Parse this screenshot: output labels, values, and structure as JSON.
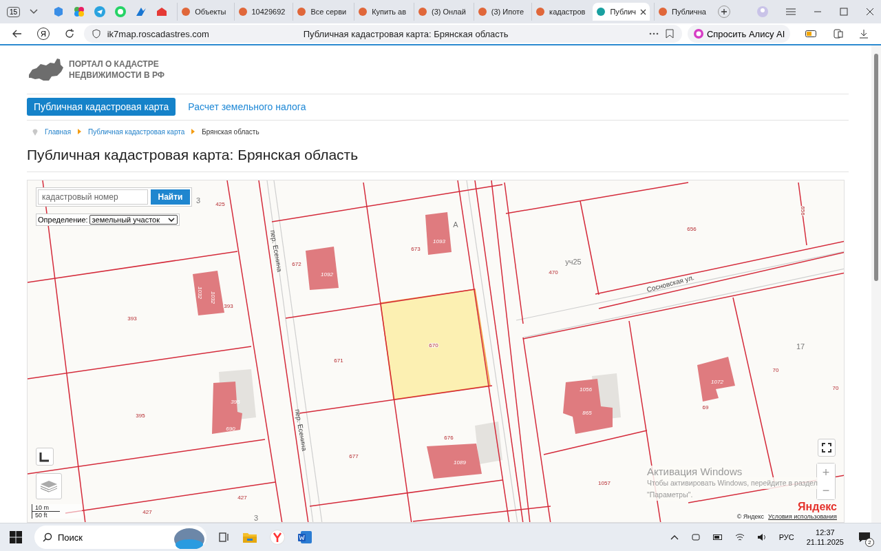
{
  "browser": {
    "tab_count": "15",
    "tabs": [
      {
        "label": "Объекты",
        "selected": false
      },
      {
        "label": "10429692",
        "selected": false
      },
      {
        "label": "Все серви",
        "selected": false
      },
      {
        "label": "Купить ав",
        "selected": false
      },
      {
        "label": "(3) Онлай",
        "selected": false
      },
      {
        "label": "(3) Ипоте",
        "selected": false
      },
      {
        "label": "кадастров",
        "selected": false
      },
      {
        "label": "Публич",
        "selected": true
      },
      {
        "label": "Публична",
        "selected": false
      }
    ],
    "logo_glyph": "Я",
    "url": "ik7map.roscadastres.com",
    "page_title": "Публичная кадастровая карта: Брянская область",
    "ask_button": "Спросить Алису AI"
  },
  "site": {
    "logo_lines": [
      "ПОРТАЛ О КАДАСТРЕ",
      "НЕДВИЖИМОСТИ В РФ"
    ],
    "nav": [
      {
        "label": "Публичная кадастровая карта",
        "selected": true
      },
      {
        "label": "Расчет земельного налога",
        "selected": false
      }
    ],
    "breadcrumbs": [
      "Главная",
      "Публичная кадастровая карта",
      "Брянская область"
    ],
    "heading": "Публичная кадастровая карта: Брянская область"
  },
  "map": {
    "search": {
      "placeholder": "кадастровый номер",
      "button": "Найти"
    },
    "definition": {
      "label": "Определение:",
      "value": "земельный участок"
    },
    "labels": [
      {
        "text": "3",
        "kind": "quarter"
      },
      {
        "text": "425",
        "kind": "parcel"
      },
      {
        "text": "393",
        "kind": "parcel"
      },
      {
        "text": "1032",
        "kind": "building"
      },
      {
        "text": "1032",
        "kind": "building"
      },
      {
        "text": "393",
        "kind": "parcel"
      },
      {
        "text": "пер. Есенина",
        "kind": "street"
      },
      {
        "text": "672",
        "kind": "parcel"
      },
      {
        "text": "1092",
        "kind": "building"
      },
      {
        "text": "673",
        "kind": "parcel"
      },
      {
        "text": "1093",
        "kind": "building"
      },
      {
        "text": "А",
        "kind": "quarter"
      },
      {
        "text": "670",
        "kind": "parcel"
      },
      {
        "text": "671",
        "kind": "parcel"
      },
      {
        "text": "уч25",
        "kind": "quarter"
      },
      {
        "text": "470",
        "kind": "parcel"
      },
      {
        "text": "656",
        "kind": "parcel"
      },
      {
        "text": "656",
        "kind": "parcel"
      },
      {
        "text": "Сосновская ул.",
        "kind": "street"
      },
      {
        "text": "17",
        "kind": "quarter"
      },
      {
        "text": "70",
        "kind": "parcel"
      },
      {
        "text": "70",
        "kind": "parcel"
      },
      {
        "text": "1072",
        "kind": "building"
      },
      {
        "text": "69",
        "kind": "parcel"
      },
      {
        "text": "1056",
        "kind": "building"
      },
      {
        "text": "865",
        "kind": "building"
      },
      {
        "text": "395",
        "kind": "parcel"
      },
      {
        "text": "395",
        "kind": "building"
      },
      {
        "text": "690",
        "kind": "building"
      },
      {
        "text": "пер. Есенина",
        "kind": "street"
      },
      {
        "text": "677",
        "kind": "parcel"
      },
      {
        "text": "676",
        "kind": "parcel"
      },
      {
        "text": "1089",
        "kind": "building"
      },
      {
        "text": "1057",
        "kind": "parcel"
      },
      {
        "text": "427",
        "kind": "parcel"
      },
      {
        "text": "427",
        "kind": "parcel"
      },
      {
        "text": "3",
        "kind": "quarter"
      }
    ],
    "scale": [
      "10 m",
      "50 ft"
    ],
    "zoom": [
      "+",
      "−"
    ],
    "provider_logo": "Яндекс",
    "copyright": "© Яндекс",
    "terms_link": "Условия использования"
  },
  "os_notice": {
    "title": "Активация Windows",
    "lines": [
      "Чтобы активировать Windows, перейдите в раздел",
      "\"Параметры\"."
    ]
  },
  "taskbar": {
    "search": "Поиск",
    "language": "РУС",
    "time": "12:37",
    "date": "21.11.2025",
    "notifications": "2"
  }
}
